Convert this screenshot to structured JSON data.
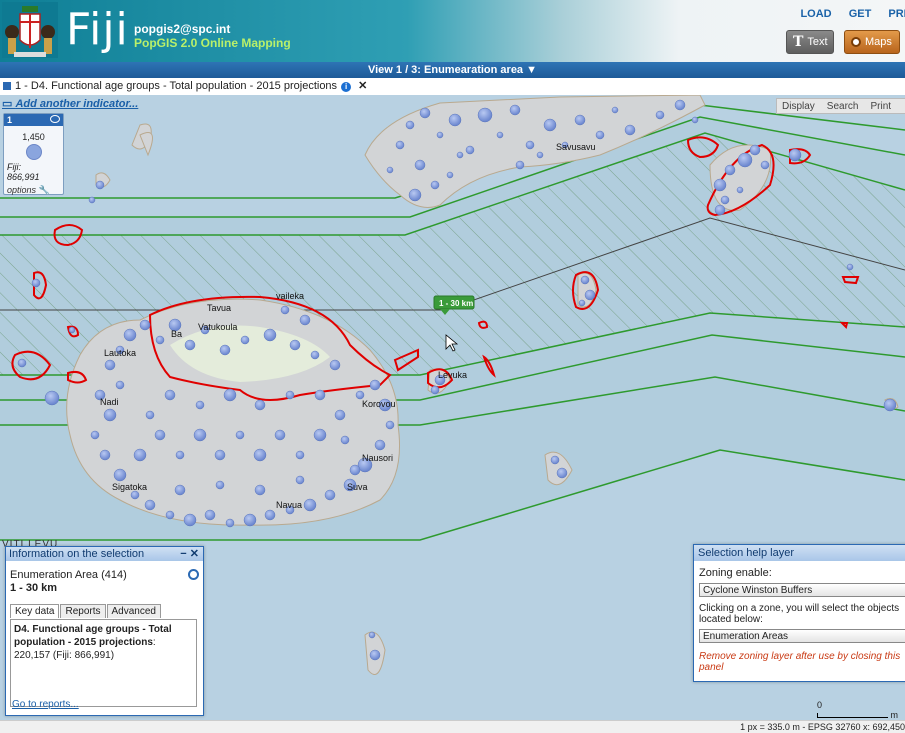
{
  "header": {
    "logo_text": "Fiji",
    "user_email": "popgis2@spc.int",
    "app_name": "PopGIS 2.0 Online Mapping",
    "links": [
      "LOAD",
      "GET",
      "PRE"
    ],
    "btn_text": "Text",
    "btn_maps": "Maps"
  },
  "view_bar": "View 1 / 3: Enumearation area",
  "indicator": {
    "label": "1 - D4. Functional age groups - Total population - 2015 projections",
    "add_link": "Add another indicator..."
  },
  "top_menu": [
    "Display",
    "Search",
    "Print"
  ],
  "legend": {
    "number": "1",
    "value": "1,450",
    "total_label": "Fiji:",
    "total_value": "866,991",
    "options": "options"
  },
  "map_labels": {
    "places": [
      "Savusavu",
      "Tavua",
      "vaileka",
      "Vatukoula",
      "Ba",
      "Lautoka",
      "Levuka",
      "Nadi",
      "Korovou",
      "Nausori",
      "Sigatoka",
      "Suva",
      "Navua"
    ],
    "marker": "1 - 30 km",
    "island": "VITI LEVU"
  },
  "selection_panel": {
    "title": "Information on the selection",
    "controls": "− ✕",
    "area": "Enumeration Area (414)",
    "zone": "1 - 30 km",
    "tabs": [
      "Key data",
      "Reports",
      "Advanced"
    ],
    "content_bold": "D4. Functional age groups - Total population - 2015 projections",
    "content_value": ": 220,157 (Fiji: 866,991)",
    "goto": "Go to reports..."
  },
  "help_panel": {
    "title": "Selection help layer",
    "zoning_label": "Zoning enable:",
    "zoning_value": "Cyclone Winston Buffers",
    "click_text": "Clicking on a zone, you will select the objects located below:",
    "objects_value": "Enumeration Areas",
    "note": "Remove zoning layer after use by closing this panel"
  },
  "scale": {
    "zero": "0",
    "unit": "m"
  },
  "status": "1 px = 335.0 m - EPSG 32760  x: 692,450"
}
